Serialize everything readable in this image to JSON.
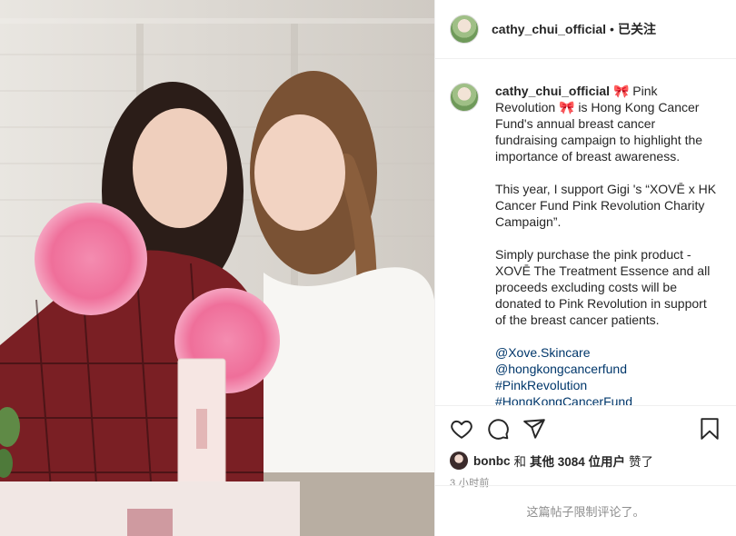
{
  "header": {
    "username": "cathy_chui_official",
    "separator": "•",
    "follow_status": "已关注"
  },
  "caption": {
    "username": "cathy_chui_official",
    "ribbon": "🎀",
    "line1": " Pink Revolution",
    "line1b": " is Hong Kong Cancer Fund's annual breast cancer fundraising campaign to highlight the importance of breast awareness.",
    "para2": "This year, I support Gigi 's “XOVĒ x HK Cancer Fund Pink Revolution Charity Campaign”.",
    "para3": "Simply purchase the pink product - XOVĒ The Treatment Essence and all proceeds excluding costs will be donated to Pink Revolution in support of the breast cancer patients.",
    "tags": [
      "@Xove.Skincare",
      "@hongkongcancerfund",
      "#PinkRevolution",
      "#HongKongCancerFund"
    ]
  },
  "actions": {
    "like_icon": "heart-icon",
    "comment_icon": "comment-icon",
    "share_icon": "paper-plane-icon",
    "save_icon": "bookmark-icon"
  },
  "likes": {
    "first_liker": "bonbc",
    "and": "和",
    "others_label": "其他 3084 位用户",
    "liked": "赞了"
  },
  "timestamp": "3 小时前",
  "comments_limited": "这篇帖子限制评论了。",
  "colors": {
    "text": "#262626",
    "secondary": "#8e8e8e",
    "link": "#00376b",
    "border": "#efefef"
  }
}
